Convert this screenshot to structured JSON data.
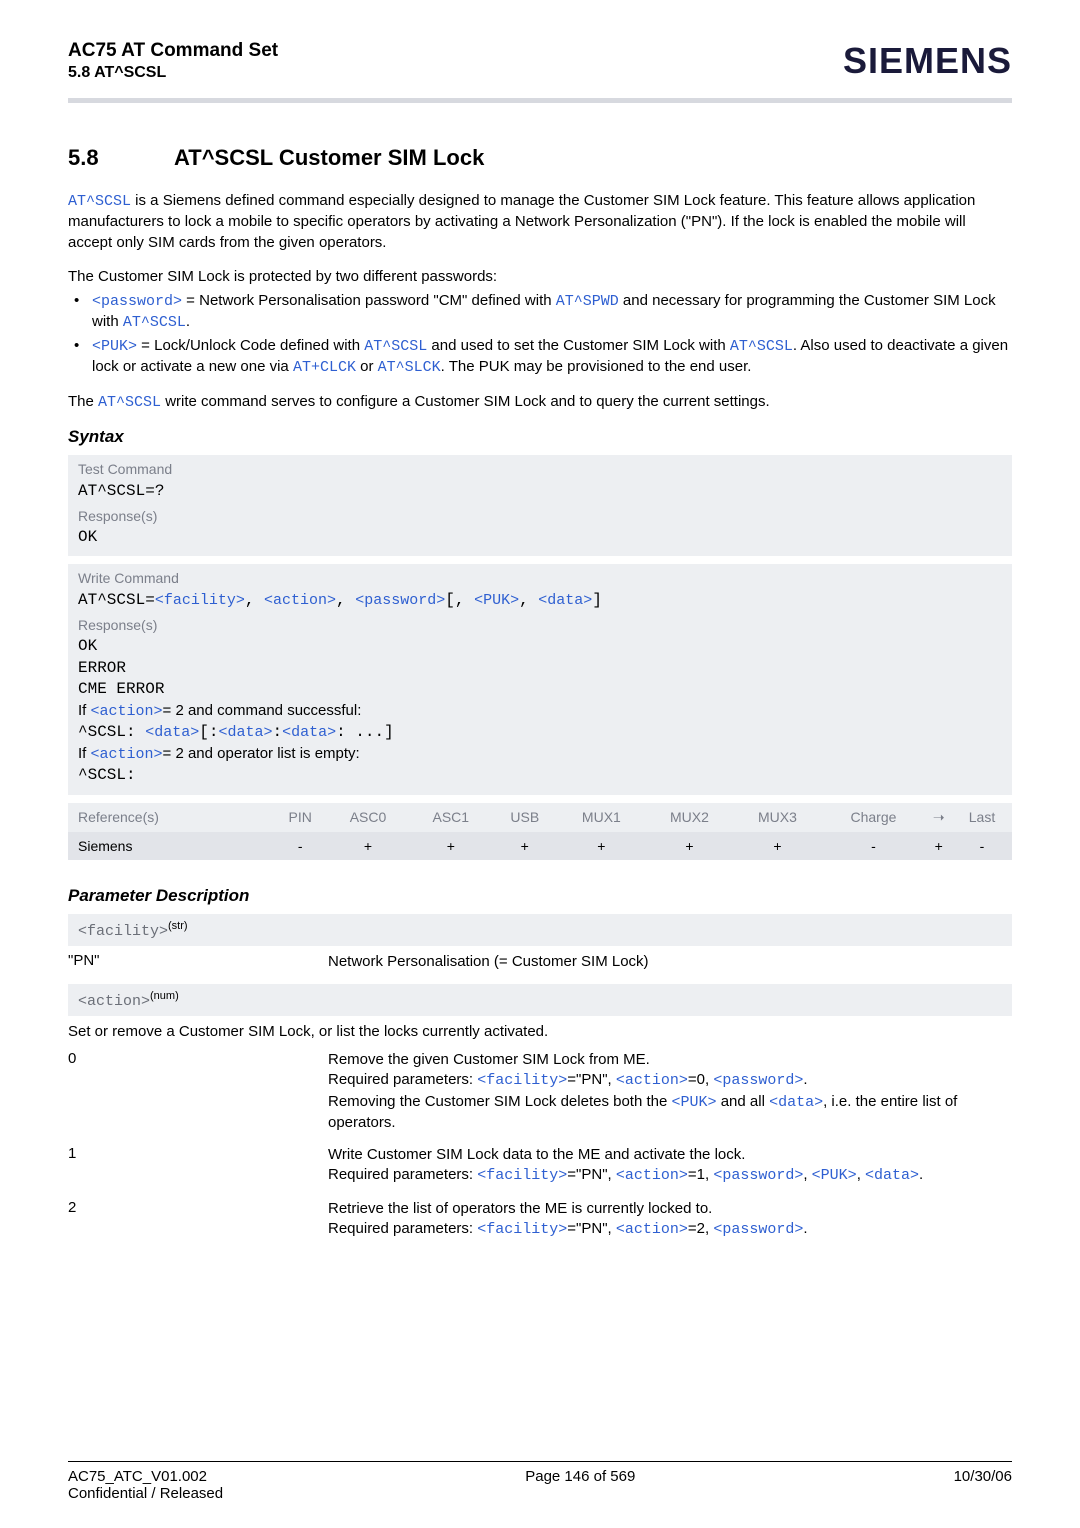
{
  "header": {
    "title": "AC75 AT Command Set",
    "subtitle": "5.8 AT^SCSL",
    "logo": "SIEMENS"
  },
  "section": {
    "number": "5.8",
    "title": "AT^SCSL   Customer SIM Lock"
  },
  "intro": {
    "cmd": "AT^SCSL",
    "para1_rest": " is a Siemens defined command especially designed to manage the Customer SIM Lock feature. This feature allows application manufacturers to lock a mobile to specific operators by activating a Network Personalization (\"PN\"). If the lock is enabled the mobile will accept only SIM cards from the given operators.",
    "para2": "The Customer SIM Lock is protected by two different passwords:",
    "b1_a": "<password>",
    "b1_b": " = Network Personalisation password \"CM\" defined with ",
    "b1_c": "AT^SPWD",
    "b1_d": " and necessary for programming the Customer SIM Lock with ",
    "b1_e": "AT^SCSL",
    "b1_f": ".",
    "b2_a": "<PUK>",
    "b2_b": " = Lock/Unlock Code defined with ",
    "b2_c": "AT^SCSL",
    "b2_d": " and used to set the Customer SIM Lock with ",
    "b2_e": "AT^SCSL",
    "b2_f": ". Also used to deactivate a given lock or activate a new one via ",
    "b2_g": "AT+CLCK",
    "b2_h": " or ",
    "b2_i": "AT^SLCK",
    "b2_j": ". The PUK may be provisioned to the end user.",
    "para3_a": "The ",
    "para3_b": "AT^SCSL",
    "para3_c": " write command serves to configure a Customer SIM Lock and to query the current settings."
  },
  "syntax_h": "Syntax",
  "test_box": {
    "label": "Test Command",
    "cmd": "AT^SCSL=?",
    "resp_label": "Response(s)",
    "ok": "OK"
  },
  "write_box": {
    "label": "Write Command",
    "cmd_a": "AT^SCSL=",
    "cmd_b": "<facility>",
    "cmd_c": ", ",
    "cmd_d": "<action>",
    "cmd_e": ", ",
    "cmd_f": "<password>",
    "cmd_g": "[, ",
    "cmd_h": "<PUK>",
    "cmd_i": ", ",
    "cmd_j": "<data>",
    "cmd_k": "]",
    "resp_label": "Response(s)",
    "l1": "OK",
    "l2": "ERROR",
    "l3": "CME ERROR",
    "l4a": "If ",
    "l4b": "<action>",
    "l4c": "= 2 and command successful:",
    "l5a": "^SCSL: ",
    "l5b": "<data>",
    "l5c": "[:",
    "l5d": "<data>",
    "l5e": ":",
    "l5f": "<data>",
    "l5g": ": ...]",
    "l6a": "If ",
    "l6b": "<action>",
    "l6c": "= 2 and operator list is empty:",
    "l7": "^SCSL:"
  },
  "ref_table": {
    "head": [
      "Reference(s)",
      "PIN",
      "ASC0",
      "ASC1",
      "USB",
      "MUX1",
      "MUX2",
      "MUX3",
      "Charge",
      "➝",
      "Last"
    ],
    "row": [
      "Siemens",
      "-",
      "+",
      "+",
      "+",
      "+",
      "+",
      "+",
      "-",
      "+",
      "-"
    ]
  },
  "param_h": "Parameter Description",
  "facility": {
    "tag": "<facility>",
    "sup": "(str)",
    "key": "\"PN\"",
    "val": "Network Personalisation (= Customer SIM Lock)"
  },
  "action": {
    "tag": "<action>",
    "sup": "(num)",
    "intro": "Set or remove a Customer SIM Lock, or list the locks currently activated.",
    "r0": {
      "k": "0",
      "l1": "Remove the given Customer SIM Lock from ME.",
      "l2a": "Required parameters: ",
      "l2b": "<facility>",
      "l2c": "=\"PN\", ",
      "l2d": "<action>",
      "l2e": "=0, ",
      "l2f": "<password>",
      "l2g": ".",
      "l3a": "Removing the Customer SIM Lock deletes both the ",
      "l3b": "<PUK>",
      "l3c": " and all ",
      "l3d": "<data>",
      "l3e": ", i.e. the entire list of operators."
    },
    "r1": {
      "k": "1",
      "l1": "Write Customer SIM Lock data to the ME and activate the lock.",
      "l2a": "Required parameters: ",
      "l2b": "<facility>",
      "l2c": "=\"PN\", ",
      "l2d": "<action>",
      "l2e": "=1, ",
      "l2f": "<password>",
      "l2g": ", ",
      "l2h": "<PUK>",
      "l2i": ", ",
      "l2j": "<data>",
      "l2k": "."
    },
    "r2": {
      "k": "2",
      "l1": "Retrieve the list of operators the ME is currently locked to.",
      "l2a": "Required parameters: ",
      "l2b": "<facility>",
      "l2c": "=\"PN\", ",
      "l2d": "<action>",
      "l2e": "=2, ",
      "l2f": "<password>",
      "l2g": "."
    }
  },
  "footer": {
    "left1": "AC75_ATC_V01.002",
    "center": "Page 146 of 569",
    "right": "10/30/06",
    "left2": "Confidential / Released"
  }
}
